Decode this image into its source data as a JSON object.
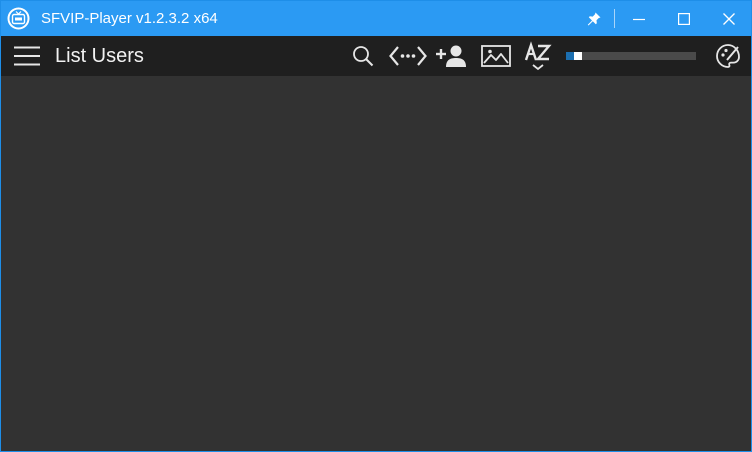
{
  "window": {
    "title": "SFVIP-Player v1.2.3.2 x64",
    "accent_color": "#2b9af3",
    "logo_icon": "iptv-tv-logo-icon",
    "controls": [
      "pin-icon",
      "minimize-icon",
      "maximize-icon",
      "close-icon"
    ]
  },
  "toolbar": {
    "title": "List Users",
    "menu_icon": "hamburger-menu-icon",
    "icons": [
      "search-icon",
      "code-arrows-icon",
      "add-user-icon",
      "image-icon",
      "sort-az-icon",
      "palette-icon"
    ],
    "volume": {
      "level": 0.06
    }
  },
  "content": {
    "items": []
  }
}
